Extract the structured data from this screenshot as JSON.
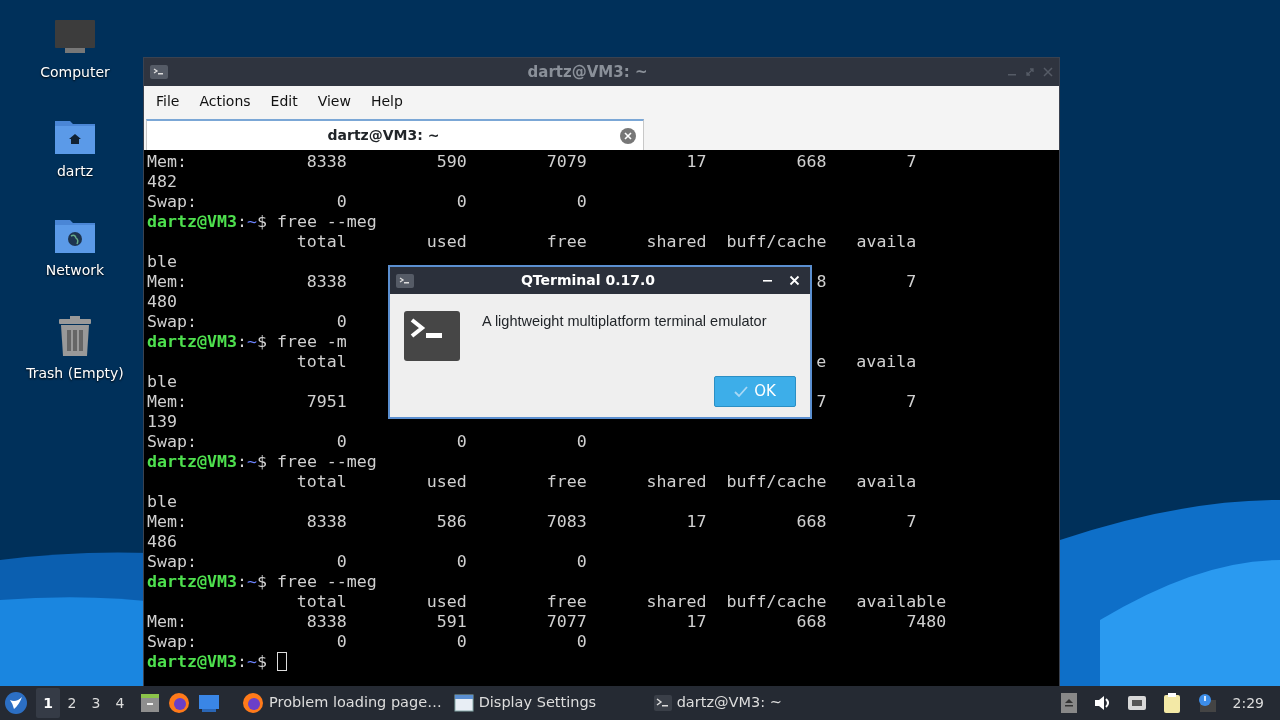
{
  "desktop_icons": [
    {
      "kind": "computer",
      "label": "Computer"
    },
    {
      "kind": "home-folder",
      "label": "dartz"
    },
    {
      "kind": "network-folder",
      "label": "Network"
    },
    {
      "kind": "trash",
      "label": "Trash (Empty)"
    }
  ],
  "window": {
    "title": "dartz@VM3: ~",
    "menu": [
      "File",
      "Actions",
      "Edit",
      "View",
      "Help"
    ],
    "tabs": [
      {
        "label": "dartz@VM3: ~",
        "selected": true
      }
    ]
  },
  "terminal": {
    "lines": [
      {
        "kind": "output",
        "text": "Mem:            8338         590        7079          17         668        7"
      },
      {
        "kind": "output",
        "text": "482"
      },
      {
        "kind": "output",
        "text": "Swap:              0           0           0"
      },
      {
        "kind": "prompt",
        "user": "dartz@VM3",
        "separator": ":",
        "path": "~",
        "symbol": "$",
        "command": "free --meg",
        "cursor": false
      },
      {
        "kind": "output",
        "text": "               total        used        free      shared  buff/cache   availa"
      },
      {
        "kind": "output",
        "text": "ble"
      },
      {
        "kind": "output",
        "text": "Mem:            8338                                               8        7"
      },
      {
        "kind": "output",
        "text": "480"
      },
      {
        "kind": "output",
        "text": "Swap:              0"
      },
      {
        "kind": "prompt",
        "user": "dartz@VM3",
        "separator": ":",
        "path": "~",
        "symbol": "$",
        "command": "free -m",
        "cursor": false
      },
      {
        "kind": "output",
        "text": "               total                                               e   availa"
      },
      {
        "kind": "output",
        "text": "ble"
      },
      {
        "kind": "output",
        "text": "Mem:            7951                                               7        7"
      },
      {
        "kind": "output",
        "text": "139"
      },
      {
        "kind": "output",
        "text": "Swap:              0           0           0"
      },
      {
        "kind": "prompt",
        "user": "dartz@VM3",
        "separator": ":",
        "path": "~",
        "symbol": "$",
        "command": "free --meg",
        "cursor": false
      },
      {
        "kind": "output",
        "text": "               total        used        free      shared  buff/cache   availa"
      },
      {
        "kind": "output",
        "text": "ble"
      },
      {
        "kind": "output",
        "text": "Mem:            8338         586        7083          17         668        7"
      },
      {
        "kind": "output",
        "text": "486"
      },
      {
        "kind": "output",
        "text": "Swap:              0           0           0"
      },
      {
        "kind": "prompt",
        "user": "dartz@VM3",
        "separator": ":",
        "path": "~",
        "symbol": "$",
        "command": "free --meg",
        "cursor": false
      },
      {
        "kind": "output",
        "text": "               total        used        free      shared  buff/cache   available"
      },
      {
        "kind": "output",
        "text": "Mem:            8338         591        7077          17         668        7480"
      },
      {
        "kind": "output",
        "text": "Swap:              0           0           0"
      },
      {
        "kind": "prompt",
        "user": "dartz@VM3",
        "separator": ":",
        "path": "~",
        "symbol": "$",
        "cursor": true
      }
    ]
  },
  "dialog": {
    "title": "QTerminal 0.17.0",
    "message": "A lightweight multiplatform terminal emulator",
    "button": "OK"
  },
  "taskbar": {
    "desktops": [
      {
        "label": "1",
        "selected": true
      },
      {
        "label": "2",
        "selected": false
      },
      {
        "label": "3",
        "selected": false
      },
      {
        "label": "4",
        "selected": false
      }
    ],
    "tasks": [
      {
        "kind": "browser",
        "label": "Problem loading page…"
      },
      {
        "kind": "window",
        "label": "Display Settings"
      },
      {
        "kind": "terminal",
        "label": "dartz@VM3: ~"
      }
    ],
    "clock": "2:29"
  }
}
